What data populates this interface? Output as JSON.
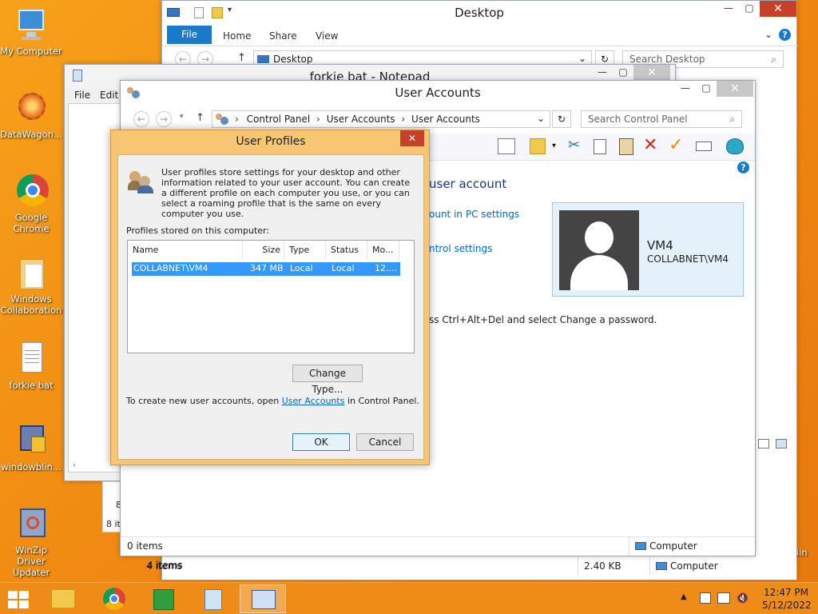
{
  "desktop_icons": [
    {
      "label": "My Computer",
      "icon": "computer-icon"
    },
    {
      "label": "DataWagon...",
      "icon": "datawagon-icon"
    },
    {
      "label": "Google Chrome",
      "icon": "chrome-icon"
    },
    {
      "label": "Windows Collaboration",
      "icon": "folder-icon"
    },
    {
      "label": "forkie bat",
      "icon": "file-icon"
    },
    {
      "label": "windowblin...",
      "icon": "windowblinds-icon"
    },
    {
      "label": "WinZip Driver Updater",
      "icon": "winzip-icon"
    }
  ],
  "explorer": {
    "title": "Desktop",
    "tabs": [
      "File",
      "Home",
      "Share",
      "View"
    ],
    "address": "Desktop",
    "search_placeholder": "Search Desktop",
    "status_items": "4 items",
    "status_size": "2.40 KB",
    "status_location": "Computer"
  },
  "notepad": {
    "title": "forkie bat - Notepad",
    "menu": [
      "File",
      "Edit"
    ],
    "peek_text": "8 it"
  },
  "user_accounts": {
    "title": "User Accounts",
    "breadcrumb": [
      "Control Panel",
      "User Accounts",
      "User Accounts"
    ],
    "search_placeholder": "Search Control Panel",
    "heading_partial": "user account",
    "link1_partial": "ount in PC settings",
    "link2_partial": "ntrol settings",
    "password_partial": "ss Ctrl+Alt+Del and select Change a password.",
    "user_name": "VM4",
    "user_account": "COLLABNET\\VM4",
    "status_items": "0 items",
    "status_location": "Computer"
  },
  "dialog": {
    "title": "User Profiles",
    "description": "User profiles store settings for your desktop and other information related to your user account. You can create a different profile on each computer you use, or you can select a roaming profile that is the same on every computer you use.",
    "profiles_label": "Profiles stored on this computer:",
    "columns": [
      "Name",
      "Size",
      "Type",
      "Status",
      "Mo..."
    ],
    "rows": [
      {
        "name": "COLLABNET\\VM4",
        "size": "347 MB",
        "type": "Local",
        "status": "Local",
        "modified": "12...."
      }
    ],
    "change_type_label": "Change Type...",
    "footer_prefix": "To create new user accounts, open",
    "footer_link": "User Accounts",
    "footer_suffix": "in Control Panel.",
    "ok_label": "OK",
    "cancel_label": "Cancel"
  },
  "taskbar": {
    "time": "12:47 PM",
    "date": "5/12/2022",
    "recycle_partial": "cle Bin"
  },
  "colors": {
    "desktop": "#f08a12",
    "dialog_frame": "#f6c673",
    "selection": "#3399ff",
    "close_red": "#c7402a"
  }
}
